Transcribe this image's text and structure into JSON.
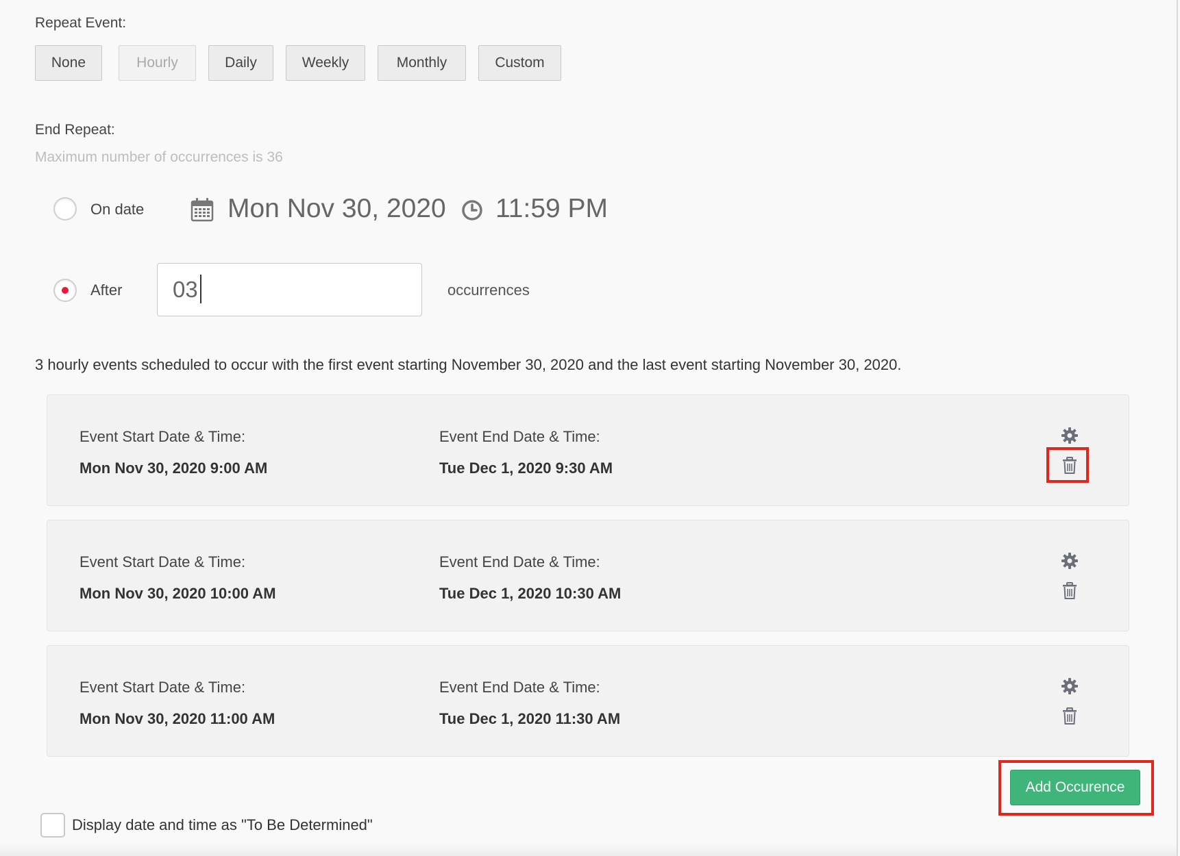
{
  "repeat": {
    "label": "Repeat Event:",
    "options": [
      "None",
      "Hourly",
      "Daily",
      "Weekly",
      "Monthly",
      "Custom"
    ],
    "selected": "Hourly"
  },
  "end_repeat": {
    "label": "End Repeat:",
    "hint": "Maximum number of occurrences is 36",
    "on_date": {
      "label": "On date",
      "date": "Mon Nov 30, 2020",
      "time": "11:59 PM",
      "checked": false
    },
    "after": {
      "label": "After",
      "value": "03",
      "suffix": "occurrences",
      "checked": true
    }
  },
  "summary": "3 hourly events scheduled to occur with the first event starting November 30, 2020 and the last event starting November 30, 2020.",
  "occurrences": [
    {
      "start_label": "Event Start Date & Time:",
      "start": "Mon Nov 30, 2020 9:00 AM",
      "end_label": "Event End Date & Time:",
      "end": "Tue Dec 1, 2020 9:30 AM"
    },
    {
      "start_label": "Event Start Date & Time:",
      "start": "Mon Nov 30, 2020 10:00 AM",
      "end_label": "Event End Date & Time:",
      "end": "Tue Dec 1, 2020 10:30 AM"
    },
    {
      "start_label": "Event Start Date & Time:",
      "start": "Mon Nov 30, 2020 11:00 AM",
      "end_label": "Event End Date & Time:",
      "end": "Tue Dec 1, 2020 11:30 AM"
    }
  ],
  "add_button": "Add Occurence",
  "tbd_label": "Display date and time as \"To Be Determined\"",
  "colors": {
    "accent_red": "#e8193c",
    "add_green": "#3fb57a",
    "highlight_red": "#e2261c"
  },
  "icons": {
    "date": "calendar-icon",
    "time": "clock-icon",
    "settings": "gear-icon",
    "delete": "trash-icon"
  }
}
